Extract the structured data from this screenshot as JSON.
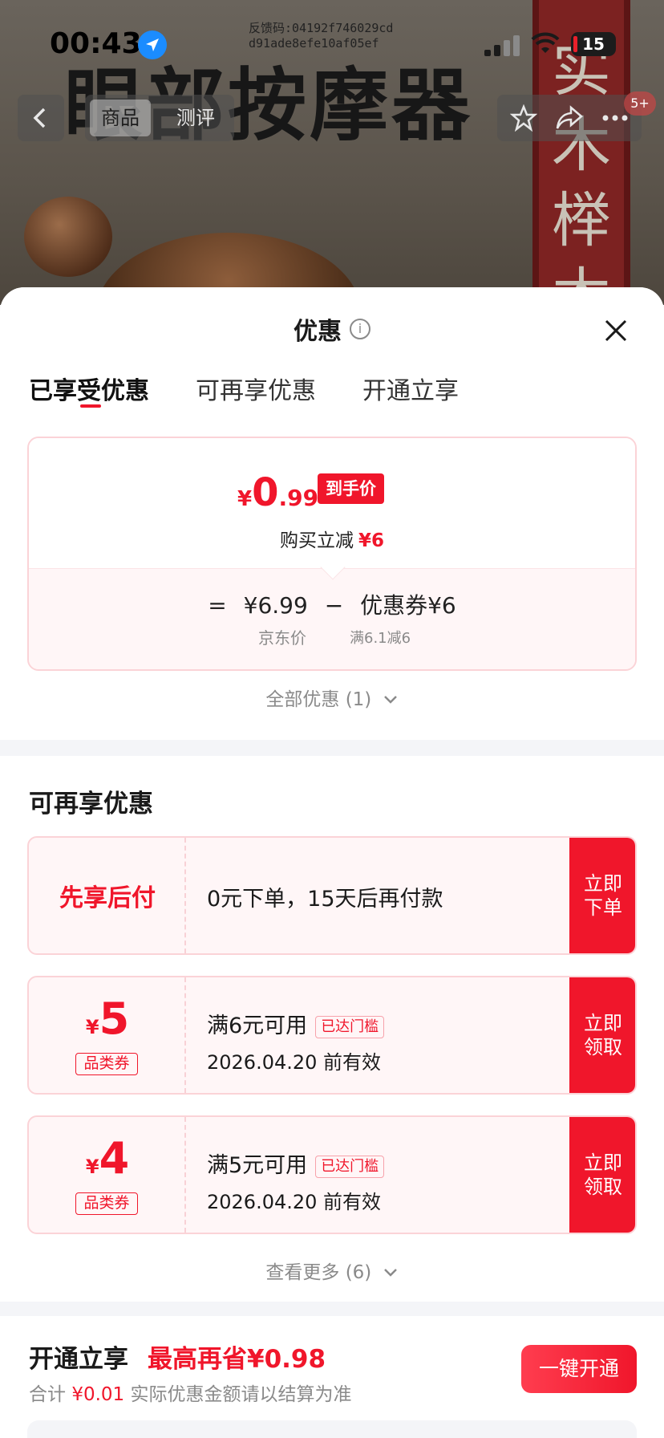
{
  "status_bar": {
    "time": "00:43",
    "feedback_line1": "反馈码:04192f746029cd",
    "feedback_line2": "d91ade8efe10af05ef",
    "battery": "15"
  },
  "product_page": {
    "heading": "眼部按摩器",
    "banner_text": "实木榉木",
    "tabs": [
      "商品",
      "测评"
    ],
    "cart_badge": "5+"
  },
  "sheet": {
    "title": "优惠",
    "tabs": [
      "已享受优惠",
      "可再享优惠",
      "开通立享"
    ],
    "price": {
      "yen": "¥",
      "integer": "0",
      "decimal": ".99",
      "tag": "到手价",
      "reduce_label": "购买立减",
      "reduce_amount": "¥6",
      "eq": "=",
      "jd_price": "¥6.99",
      "minus": "−",
      "coupon_label": "优惠券¥6",
      "jd_label": "京东价",
      "coupon_condition": "满6.1减6"
    },
    "all_discounts": "全部优惠 (1)",
    "more_section": {
      "heading": "可再享优惠",
      "pay_later": {
        "title": "先享后付",
        "text": "0元下单，15天后再付款",
        "button": "立即下单"
      },
      "coupons": [
        {
          "yen": "¥",
          "value": "5",
          "badge": "品类券",
          "condition": "满6元可用",
          "reach": "已达门槛",
          "validity": "2026.04.20 前有效",
          "button": "立即领取"
        },
        {
          "yen": "¥",
          "value": "4",
          "badge": "品类券",
          "condition": "满5元可用",
          "reach": "已达门槛",
          "validity": "2026.04.20 前有效",
          "button": "立即领取"
        }
      ],
      "see_more": "查看更多 (6)"
    },
    "open_section": {
      "title": "开通立享",
      "save": "最高再省¥0.98",
      "total_label": "合计",
      "total_amount": "¥0.01",
      "note": "实际优惠金额请以结算为准",
      "button": "一键开通"
    }
  },
  "colors": {
    "accent": "#f0162b",
    "text": "#1a1a1a",
    "muted": "#8a8a8a",
    "card_bg": "#fff6f7"
  }
}
